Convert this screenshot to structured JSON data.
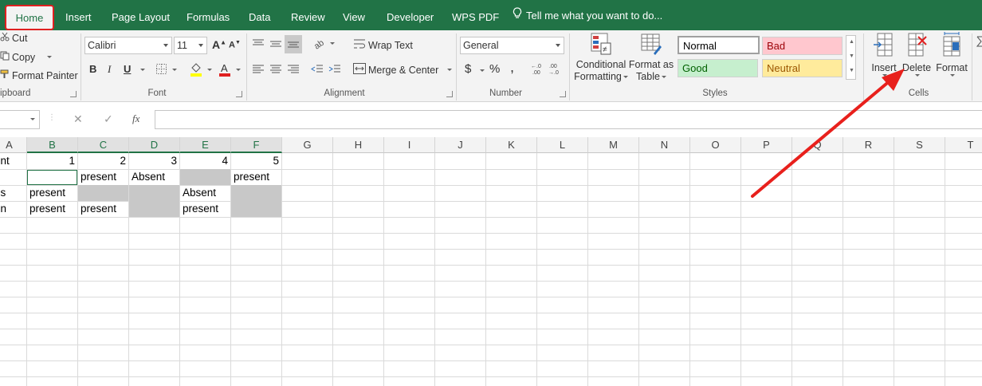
{
  "tabs": [
    "Home",
    "Insert",
    "Page Layout",
    "Formulas",
    "Data",
    "Review",
    "View",
    "Developer",
    "WPS PDF"
  ],
  "tell_me": "Tell me what you want to do...",
  "clipboard": {
    "cut": "Cut",
    "copy": "Copy",
    "format_painter": "Format Painter",
    "group": "ipboard"
  },
  "font": {
    "name": "Calibri",
    "size": "11",
    "bold": "B",
    "italic": "I",
    "underline": "U",
    "grow": "A",
    "shrink": "A",
    "group": "Font"
  },
  "alignment": {
    "wrap": "Wrap Text",
    "merge": "Merge & Center",
    "group": "Alignment"
  },
  "number": {
    "format": "General",
    "currency": "$",
    "percent": "%",
    "comma": ",",
    "inc_decimal": "←.0\n.00",
    "dec_decimal": ".00\n→.0",
    "group": "Number"
  },
  "styles": {
    "conditional_1": "Conditional",
    "conditional_2": "Formatting",
    "format_table_1": "Format as",
    "format_table_2": "Table",
    "normal": "Normal",
    "bad": "Bad",
    "good": "Good",
    "neutral": "Neutral",
    "group": "Styles"
  },
  "cells": {
    "insert": "Insert",
    "delete": "Delete",
    "format": "Format",
    "group": "Cells"
  },
  "formula_bar": {
    "cancel": "✕",
    "enter": "✓",
    "fx": "fx"
  },
  "columns": [
    "A",
    "B",
    "C",
    "D",
    "E",
    "F",
    "G",
    "H",
    "I",
    "J",
    "K",
    "L",
    "M",
    "N",
    "O",
    "P",
    "Q",
    "R",
    "S",
    "T"
  ],
  "rows": [
    [
      "ent",
      "1",
      "2",
      "3",
      "4",
      "5"
    ],
    [
      "-",
      "",
      "present",
      "Absent",
      "",
      "present"
    ],
    [
      "es",
      "present",
      "",
      "",
      "Absent",
      ""
    ],
    [
      "on",
      "present",
      "present",
      "",
      "present",
      ""
    ]
  ],
  "colors": {
    "accent": "#217346",
    "annotation": "#e02020",
    "bad_bg": "#ffc7ce",
    "bad_fg": "#9c0006",
    "good_bg": "#c6efce",
    "good_fg": "#006100",
    "neutral_bg": "#ffeb9c",
    "neutral_fg": "#9c5700",
    "filled_cell": "#c8c8c8"
  }
}
